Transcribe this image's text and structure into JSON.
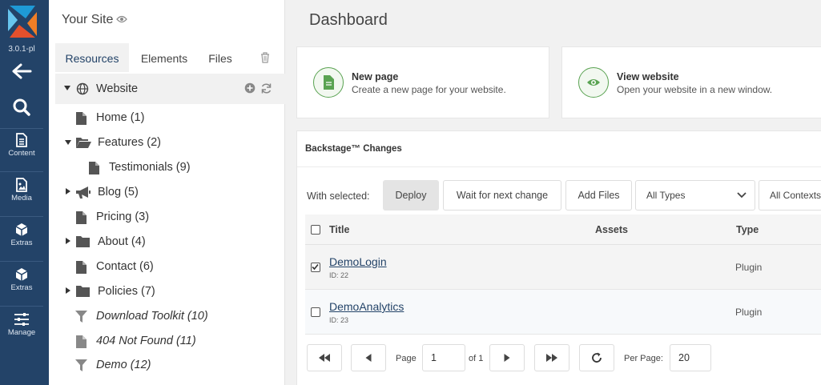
{
  "rail": {
    "version": "3.0.1-pl",
    "items": [
      {
        "label": "Content",
        "icon": "file-text-icon"
      },
      {
        "label": "Media",
        "icon": "file-image-icon"
      },
      {
        "label": "Extras",
        "icon": "cube-icon"
      },
      {
        "label": "Extras",
        "icon": "cube-icon"
      },
      {
        "label": "Manage",
        "icon": "sliders-icon"
      }
    ]
  },
  "tree": {
    "site_name": "Your Site",
    "tabs": [
      "Resources",
      "Elements",
      "Files"
    ],
    "root": "Website",
    "nodes": [
      {
        "label": "Home (1)",
        "icon": "page-icon"
      },
      {
        "label": "Features (2)",
        "icon": "folder-open-icon"
      },
      {
        "label": "Testimonials (9)",
        "icon": "page-icon"
      },
      {
        "label": "Blog (5)",
        "icon": "megaphone-icon"
      },
      {
        "label": "Pricing (3)",
        "icon": "page-icon"
      },
      {
        "label": "About (4)",
        "icon": "folder-icon"
      },
      {
        "label": "Contact (6)",
        "icon": "page-icon"
      },
      {
        "label": "Policies (7)",
        "icon": "folder-icon"
      },
      {
        "label": "Download Toolkit (10)",
        "icon": "filter-icon"
      },
      {
        "label": "404 Not Found (11)",
        "icon": "page-icon"
      },
      {
        "label": "Demo (12)",
        "icon": "filter-icon"
      }
    ]
  },
  "dashboard": {
    "title": "Dashboard",
    "cards": [
      {
        "title": "New page",
        "desc": "Create a new page for your website."
      },
      {
        "title": "View website",
        "desc": "Open your website in a new window."
      }
    ]
  },
  "changes": {
    "heading": "Backstage™ Changes",
    "with_selected": "With selected:",
    "deploy": "Deploy",
    "wait": "Wait for next change",
    "add_files": "Add Files",
    "types_select": "All Types",
    "contexts_select": "All Contexts",
    "columns": [
      "Title",
      "Assets",
      "Type"
    ],
    "rows": [
      {
        "name": "DemoLogin",
        "id": "ID: 22",
        "type": "Plugin",
        "checked": true
      },
      {
        "name": "DemoAnalytics",
        "id": "ID: 23",
        "type": "Plugin",
        "checked": false
      }
    ],
    "pager": {
      "page_label": "Page",
      "page_value": "1",
      "of_label": "of 1",
      "per_page_label": "Per Page:",
      "per_page_value": "20"
    }
  },
  "colors": {
    "rail": "#234368",
    "accent_green": "#5aa352"
  }
}
